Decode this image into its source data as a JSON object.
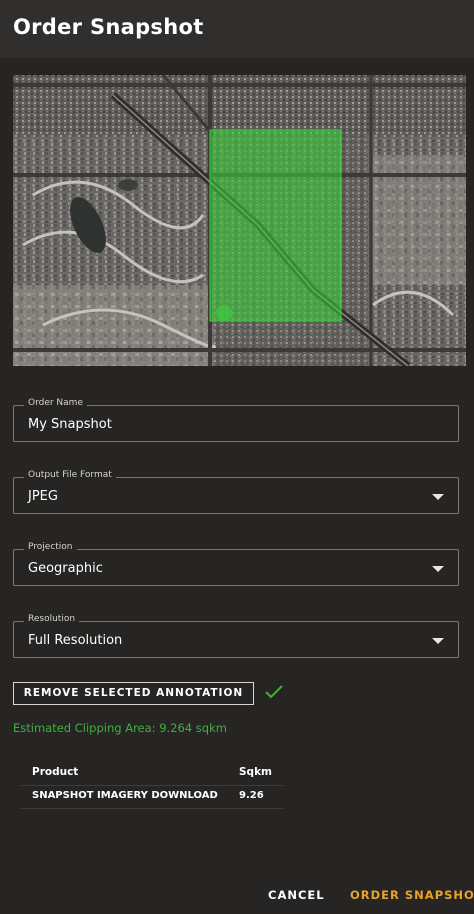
{
  "dialog": {
    "title": "Order Snapshot"
  },
  "map": {
    "selection_color": "#3ad13a"
  },
  "form": {
    "order_name": {
      "label": "Order Name",
      "value": "My Snapshot"
    },
    "output_format": {
      "label": "Output File Format",
      "value": "JPEG"
    },
    "projection": {
      "label": "Projection",
      "value": "Geographic"
    },
    "resolution": {
      "label": "Resolution",
      "value": "Full Resolution"
    }
  },
  "annotation": {
    "remove_label": "REMOVE SELECTED ANNOTATION",
    "status_icon": "check-icon"
  },
  "estimate": {
    "text": "Estimated Clipping Area: 9.264 sqkm"
  },
  "table": {
    "headers": {
      "product": "Product",
      "sqkm": "Sqkm"
    },
    "rows": [
      {
        "product": "SNAPSHOT IMAGERY DOWNLOAD",
        "sqkm": "9.26"
      }
    ]
  },
  "actions": {
    "cancel": "CANCEL",
    "order": "ORDER SNAPSHOT"
  },
  "colors": {
    "accent": "#e9a329",
    "success": "#3db13d",
    "background": "#262523"
  }
}
